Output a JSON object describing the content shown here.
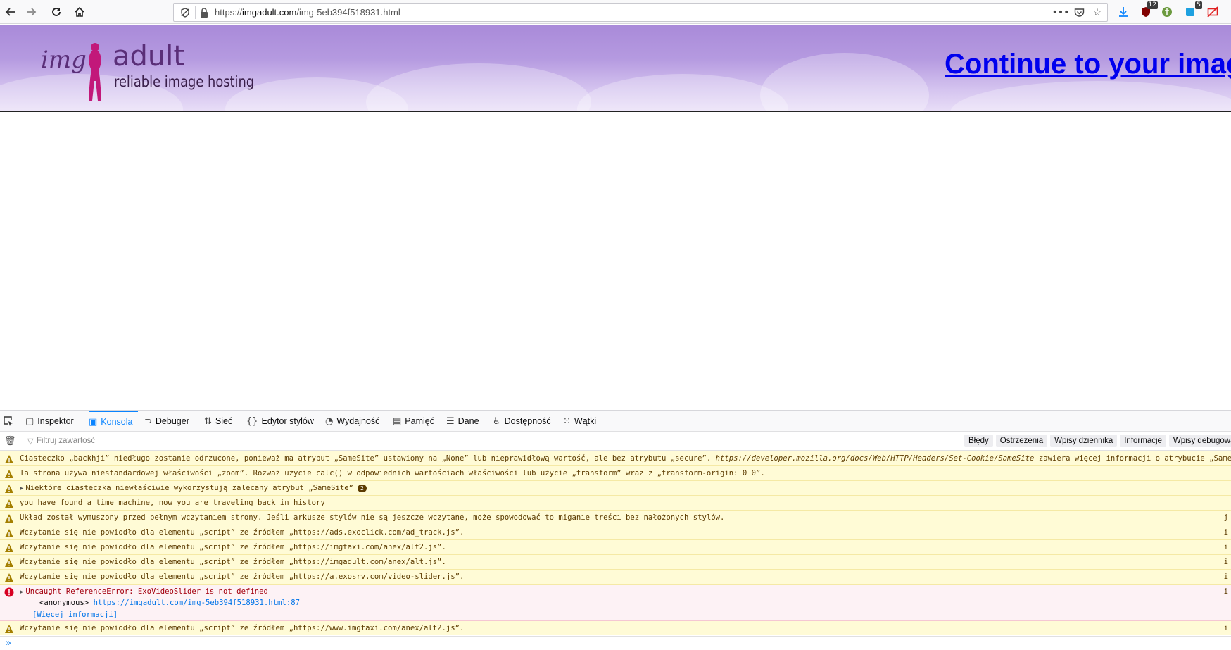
{
  "browser": {
    "url_prefix": "https://",
    "url_host": "imgadult.com",
    "url_path": "/img-5eb394f518931.html",
    "extension_badges": [
      "12",
      "5"
    ]
  },
  "page": {
    "logo_img": "img",
    "logo_adult": "adult",
    "logo_tagline": "reliable image hosting",
    "continue_link": "Continue to your image..."
  },
  "devtools": {
    "tabs": [
      {
        "label": "Inspektor",
        "icon": "inspector-icon"
      },
      {
        "label": "Konsola",
        "icon": "console-icon"
      },
      {
        "label": "Debuger",
        "icon": "debugger-icon"
      },
      {
        "label": "Sieć",
        "icon": "network-icon"
      },
      {
        "label": "Edytor stylów",
        "icon": "style-editor-icon"
      },
      {
        "label": "Wydajność",
        "icon": "performance-icon"
      },
      {
        "label": "Pamięć",
        "icon": "memory-icon"
      },
      {
        "label": "Dane",
        "icon": "storage-icon"
      },
      {
        "label": "Dostępność",
        "icon": "accessibility-icon"
      },
      {
        "label": "Wątki",
        "icon": "threads-icon"
      }
    ],
    "active_tab": "Konsola",
    "filter_placeholder": "Filtruj zawartość",
    "levels": [
      "Błędy",
      "Ostrzeżenia",
      "Wpisy dziennika",
      "Informacje",
      "Wpisy debugowania"
    ],
    "messages": [
      {
        "type": "warning",
        "text": "Ciasteczko „backhji” niedługo zostanie odrzucone, ponieważ ma atrybut „SameSite” ustawiony na „None” lub nieprawidłową wartość, ale bez atrybutu „secure”. ",
        "link": "https://developer.mozilla.org/docs/Web/HTTP/Headers/Set-Cookie/SameSite",
        "tail": " zawiera więcej informacji o atrybucie „SameSite”",
        "source": ""
      },
      {
        "type": "warning",
        "text": "Ta strona używa niestandardowej właściwości „zoom”. Rozważ użycie calc() w odpowiednich wartościach właściwości lub użycie „transform” wraz z „transform-origin: 0 0”.",
        "source": ""
      },
      {
        "type": "warning",
        "text": "Niektóre ciasteczka niewłaściwie wykorzystują zalecany atrybut „SameSite”",
        "count": "2",
        "source": ""
      },
      {
        "type": "warning",
        "text": "you have found a time machine, now you are traveling back in history",
        "source": ""
      },
      {
        "type": "warning",
        "text": "Układ został wymuszony przed pełnym wczytaniem strony. Jeśli arkusze stylów nie są jeszcze wczytane, może spowodować to miganie treści bez nałożonych stylów.",
        "source": "j"
      },
      {
        "type": "warning",
        "text": "Wczytanie się nie powiodło dla elementu „script” ze źródłem „https://ads.exoclick.com/ad_track.js”.",
        "source": "i"
      },
      {
        "type": "warning",
        "text": "Wczytanie się nie powiodło dla elementu „script” ze źródłem „https://imgtaxi.com/anex/alt2.js”.",
        "source": "i"
      },
      {
        "type": "warning",
        "text": "Wczytanie się nie powiodło dla elementu „script” ze źródłem „https://imgadult.com/anex/alt.js”.",
        "source": "i"
      },
      {
        "type": "warning",
        "text": "Wczytanie się nie powiodło dla elementu „script” ze źródłem „https://a.exosrv.com/video-slider.js”.",
        "source": "i"
      }
    ],
    "error": {
      "text": "Uncaught ReferenceError: ExoVideoSlider is not defined",
      "stack_fn": "<anonymous>",
      "stack_link": "https://imgadult.com/img-5eb394f518931.html:87",
      "more": "[Więcej informacji]",
      "source": "i"
    },
    "last_message": {
      "type": "warning",
      "text": "Wczytanie się nie powiodło dla elementu „script” ze źródłem „https://www.imgtaxi.com/anex/alt2.js”.",
      "source": "i"
    },
    "prompt": "»"
  }
}
